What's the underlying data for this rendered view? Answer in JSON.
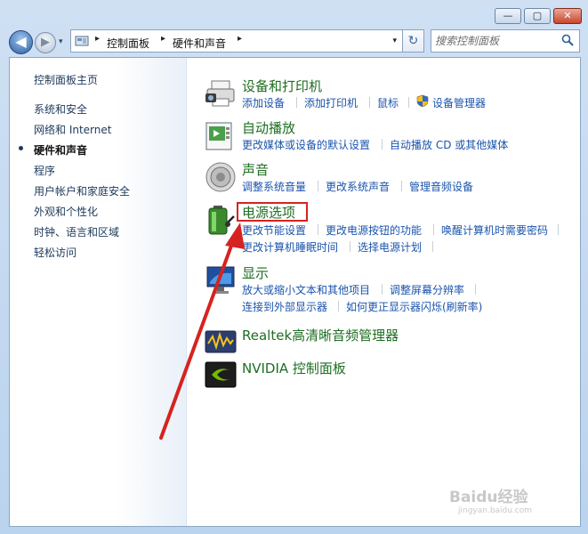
{
  "window": {
    "min_label": "—",
    "max_label": "▢",
    "close_label": "✕"
  },
  "nav": {
    "back_glyph": "◀",
    "forward_glyph": "▶",
    "dropdown_glyph": "▾",
    "refresh_glyph": "↻",
    "breadcrumb": [
      "控制面板",
      "硬件和声音"
    ],
    "crumb_sep": "▸",
    "search_placeholder": "搜索控制面板"
  },
  "sidebar": {
    "items": [
      {
        "label": "控制面板主页",
        "active": false
      },
      {
        "label": "系统和安全",
        "active": false
      },
      {
        "label": "网络和 Internet",
        "active": false
      },
      {
        "label": "硬件和声音",
        "active": true
      },
      {
        "label": "程序",
        "active": false
      },
      {
        "label": "用户帐户和家庭安全",
        "active": false
      },
      {
        "label": "外观和个性化",
        "active": false
      },
      {
        "label": "时钟、语言和区域",
        "active": false
      },
      {
        "label": "轻松访问",
        "active": false
      }
    ]
  },
  "categories": [
    {
      "title": "设备和打印机",
      "icon": "printer-camera-icon",
      "links": [
        [
          "添加设备",
          "添加打印机",
          "鼠标",
          "设备管理器"
        ]
      ]
    },
    {
      "title": "自动播放",
      "icon": "autoplay-icon",
      "links": [
        [
          "更改媒体或设备的默认设置",
          "自动播放 CD 或其他媒体"
        ]
      ]
    },
    {
      "title": "声音",
      "icon": "speaker-icon",
      "links": [
        [
          "调整系统音量",
          "更改系统声音",
          "管理音频设备"
        ]
      ]
    },
    {
      "title": "电源选项",
      "icon": "battery-icon",
      "links": [
        [
          "更改节能设置",
          "更改电源按钮的功能",
          "唤醒计算机时需要密码"
        ],
        [
          "更改计算机睡眠时间",
          "选择电源计划"
        ]
      ]
    },
    {
      "title": "显示",
      "icon": "monitor-icon",
      "links": [
        [
          "放大或缩小文本和其他项目",
          "调整屏幕分辨率"
        ],
        [
          "连接到外部显示器",
          "如何更正显示器闪烁(刷新率)"
        ]
      ]
    },
    {
      "title": "Realtek高清晰音频管理器",
      "icon": "realtek-audio-icon",
      "links": []
    },
    {
      "title": "NVIDIA 控制面板",
      "icon": "nvidia-icon",
      "links": []
    }
  ],
  "watermark": {
    "text": "Baidu经验",
    "url": "jingyan.baidu.com"
  },
  "colors": {
    "title_green": "#1e6e21",
    "link_blue": "#1b54ad",
    "highlight_red": "#d6231f",
    "sidebar_text": "#1e395b"
  }
}
